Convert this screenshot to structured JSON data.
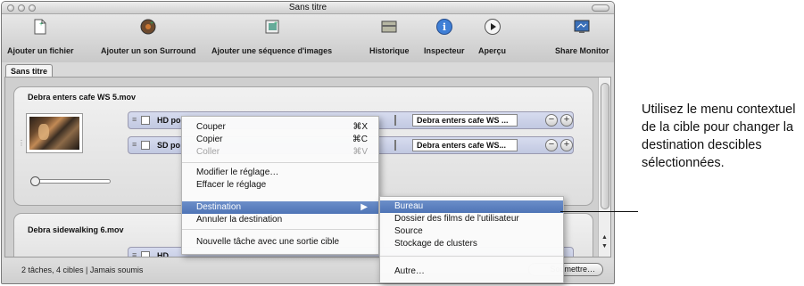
{
  "window": {
    "title": "Sans titre"
  },
  "toolbar": {
    "add_file": "Ajouter un fichier",
    "add_surround": "Ajouter un son Surround",
    "add_sequence": "Ajouter une séquence d'images",
    "history": "Historique",
    "inspector": "Inspecteur",
    "preview": "Aperçu",
    "share_monitor": "Share Monitor"
  },
  "tabs": {
    "current": "Sans titre"
  },
  "jobs": [
    {
      "name": "Debra enters cafe WS 5.mov",
      "targets": [
        {
          "label": "HD po",
          "destination": "Debra enters cafe WS ..."
        },
        {
          "label": "SD po",
          "destination": "Debra enters cafe WS..."
        }
      ]
    },
    {
      "name": "Debra sidewalking 6.mov",
      "targets": [
        {
          "label": "HD"
        }
      ]
    }
  ],
  "context_menu": {
    "cut": "Couper",
    "cut_shortcut": "⌘X",
    "copy": "Copier",
    "copy_shortcut": "⌘C",
    "paste": "Coller",
    "paste_shortcut": "⌘V",
    "modify": "Modifier le réglage…",
    "clear": "Effacer le réglage",
    "destination": "Destination",
    "cancel_destination": "Annuler la destination",
    "new_task": "Nouvelle tâche avec une sortie cible"
  },
  "submenu": {
    "desktop": "Bureau",
    "user_movies": "Dossier des films de l'utilisateur",
    "source": "Source",
    "cluster_storage": "Stockage de clusters",
    "other": "Autre…"
  },
  "status": {
    "text": "2 tâches, 4 cibles  |  Jamais soumis",
    "submit": "Soumettre…"
  },
  "callout": {
    "text": "Utilisez le menu contextuel de la cible pour changer la destination descibles sélectionnées."
  }
}
